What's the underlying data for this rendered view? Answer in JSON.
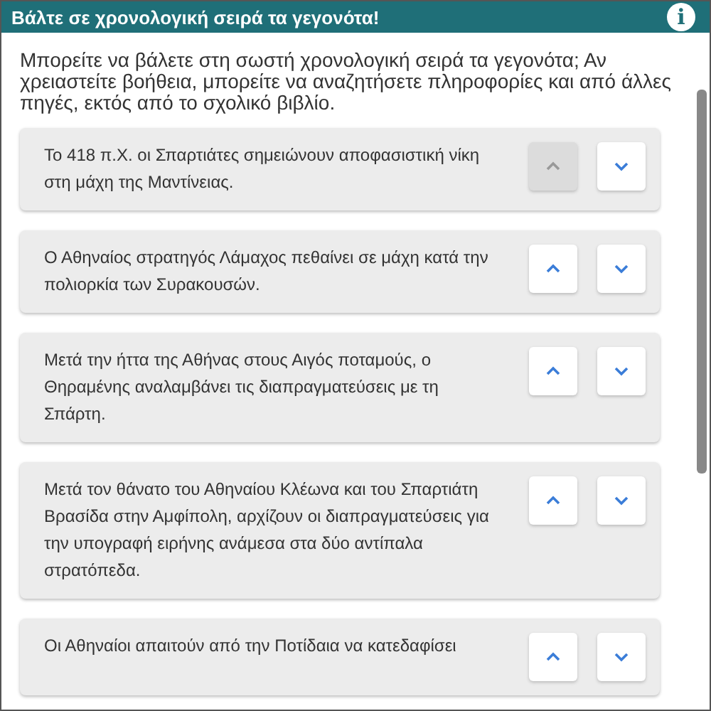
{
  "header": {
    "title": "Βάλτε σε χρονολογική σειρά τα γεγονότα!",
    "info": "i"
  },
  "instructions": "Μπορείτε να βάλετε στη σωστή χρονολογική σειρά τα γεγονότα; Αν χρειαστείτε βοήθεια, μπορείτε να αναζητήσετε πληροφορίες και από άλλες πηγές, εκτός από το σχολικό βιβλίο.",
  "events": [
    {
      "text": "Το 418 π.Χ. οι Σπαρτιάτες σημειώνουν αποφασιστική νίκη στη μάχη της Μαντίνειας.",
      "up_disabled": true,
      "down_disabled": false
    },
    {
      "text": "Ο Αθηναίος στρατηγός Λάμαχος πεθαίνει σε μάχη κατά την πολιορκία των Συρακουσών.",
      "up_disabled": false,
      "down_disabled": false
    },
    {
      "text": "Μετά την ήττα της Αθήνας στους Αιγός ποταμούς, ο Θηραμένης αναλαμβάνει τις διαπραγματεύσεις με τη Σπάρτη.",
      "up_disabled": false,
      "down_disabled": false
    },
    {
      "text": "Μετά τον θάνατο του Αθηναίου Κλέωνα και του Σπαρτιάτη Βρασίδα στην Αμφίπολη, αρχίζουν οι διαπραγματεύσεις για την υπογραφή ειρήνης ανάμεσα στα δύο αντίπαλα στρατόπεδα.",
      "up_disabled": false,
      "down_disabled": false
    },
    {
      "text": "Οι Αθηναίοι απαιτούν από την Ποτίδαια να κατεδαφίσει",
      "up_disabled": false,
      "down_disabled": false
    }
  ]
}
